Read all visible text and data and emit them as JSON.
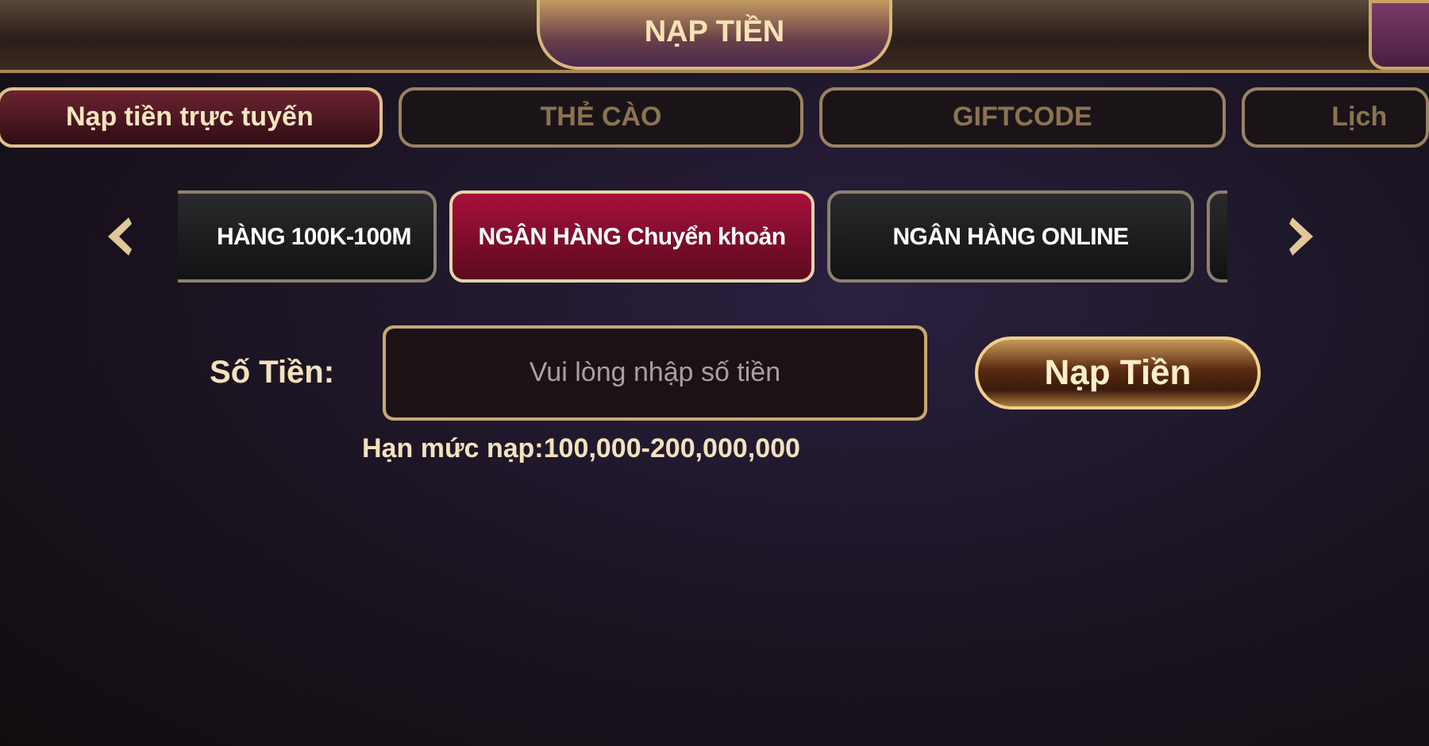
{
  "header": {
    "title": "NẠP TIỀN"
  },
  "tabs": [
    {
      "label": "Nạp tiền trực tuyến",
      "selected": true
    },
    {
      "label": "THẺ CÀO",
      "selected": false
    },
    {
      "label": "GIFTCODE",
      "selected": false
    },
    {
      "label": "Lịch",
      "selected": false
    }
  ],
  "methods": [
    {
      "label": "HÀNG 100K-100M",
      "selected": false
    },
    {
      "label": "NGÂN HÀNG Chuyển khoản",
      "selected": true
    },
    {
      "label": "NGÂN HÀNG ONLINE",
      "selected": false
    }
  ],
  "form": {
    "label": "Số Tiền:",
    "amount": {
      "placeholder": "Vui lòng nhập số tiền"
    },
    "submit": "Nạp Tiền",
    "limit": "Hạn mức nạp:100,000-200,000,000"
  }
}
